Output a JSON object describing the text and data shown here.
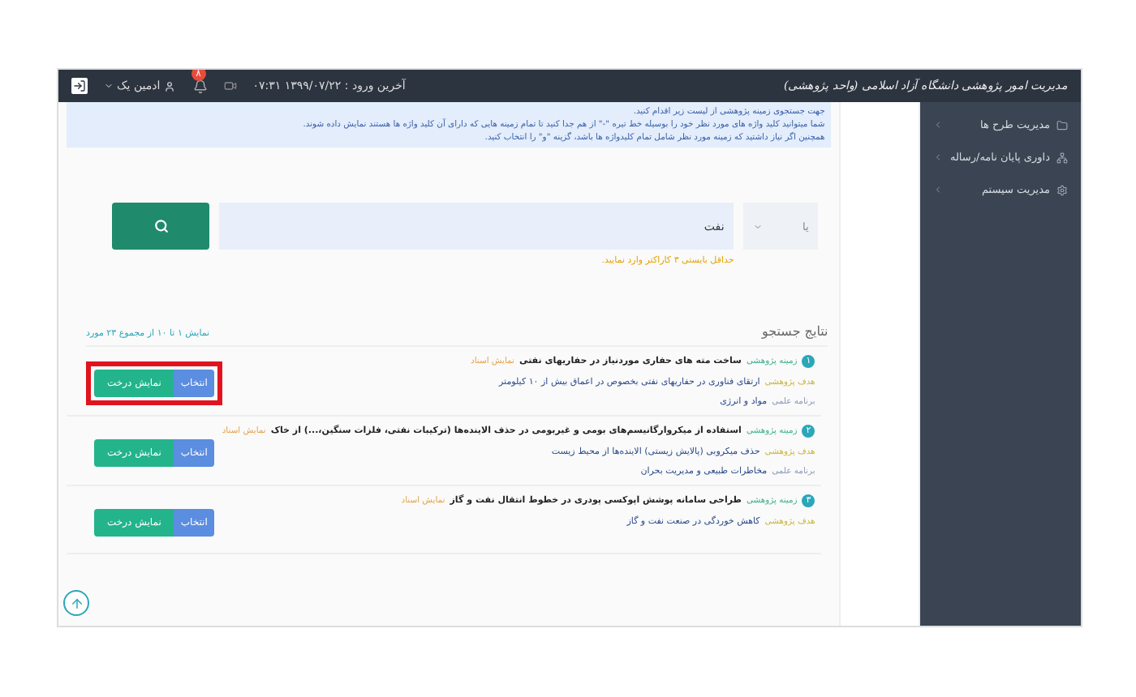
{
  "header": {
    "title": "مدیریت امور پژوهشی دانشگاه آزاد اسلامی (واحد پژوهشی)",
    "last_login": "آخرین ورود : ۱۳۹۹/۰۷/۲۲ ۰۷:۳۱",
    "notification_count": "۸",
    "user": "ادمین یک"
  },
  "sidebar": {
    "items": [
      {
        "label": "مدیریت طرح ها",
        "selected": false
      },
      {
        "label": "داوری پایان نامه/رساله",
        "selected": false
      },
      {
        "label": "مدیریت سیستم",
        "selected": false
      }
    ]
  },
  "info": [
    "جهت جستجوی زمینه پژوهشی از لیست زیر اقدام کنید.",
    "شما میتوانید کلید واژه های مورد نظر خود را بوسیله خط تیره \"-\" از هم جدا کنید تا تمام زمینه هایی که دارای آن کلید واژه ها هستند نمایش داده شوند.",
    "همچنین اگر نیاز داشتید که زمینه مورد نظر شامل تمام کلیدواژه ها باشد، گزینه \"و\" را انتخاب کنید."
  ],
  "search": {
    "operator": "یا",
    "value": "نفت",
    "hint": "حداقل بایستی ۳ کاراکتر وارد نمایید."
  },
  "results_title": "نتایج جستجو",
  "results_count": "نمایش ۱ تا ۱۰ از مجموع ۲۳ مورد",
  "results": [
    {
      "number": "۱",
      "field_label": "زمینه پژوهشی",
      "title": "ساخت مته های حفاری موردنیاز در حفاریهای نفتی",
      "link": "نمایش اسناد",
      "goal_label": "هدف پژوهشی",
      "goal": "ارتقای فناوری در حفاریهای نفتی بخصوص در اعماق بیش از ۱۰ کیلومتر",
      "program_label": "برنامه علمی",
      "program": "مواد و انرژی",
      "select": "انتخاب",
      "tree": "نمایش درخت",
      "highlighted": true
    },
    {
      "number": "۲",
      "field_label": "زمینه پژوهشی",
      "title": "استفاده از میکروارگانیسم‌های بومی و غیربومی در حذف الاینده‌ها (ترکیبات نفتی، فلزات سنگین،...) از خاک",
      "link": "نمایش اسناد",
      "goal_label": "هدف پژوهشی",
      "goal": "حذف میکروبی (پالایش زیستی) الاینده‌ها از محیط زیست",
      "program_label": "برنامه علمی",
      "program": "مخاطرات طبیعی و مدیریت بحران",
      "select": "انتخاب",
      "tree": "نمایش درخت",
      "highlighted": false
    },
    {
      "number": "۳",
      "field_label": "زمینه پژوهشی",
      "title": "طراحی سامانه پوشش اپوکسی پودری در خطوط انتقال نفت و گاز",
      "link": "نمایش اسناد",
      "goal_label": "هدف پژوهشی",
      "goal": "کاهش خوردگی در صنعت نفت و گاز",
      "select": "انتخاب",
      "tree": "نمایش درخت",
      "highlighted": false
    }
  ]
}
